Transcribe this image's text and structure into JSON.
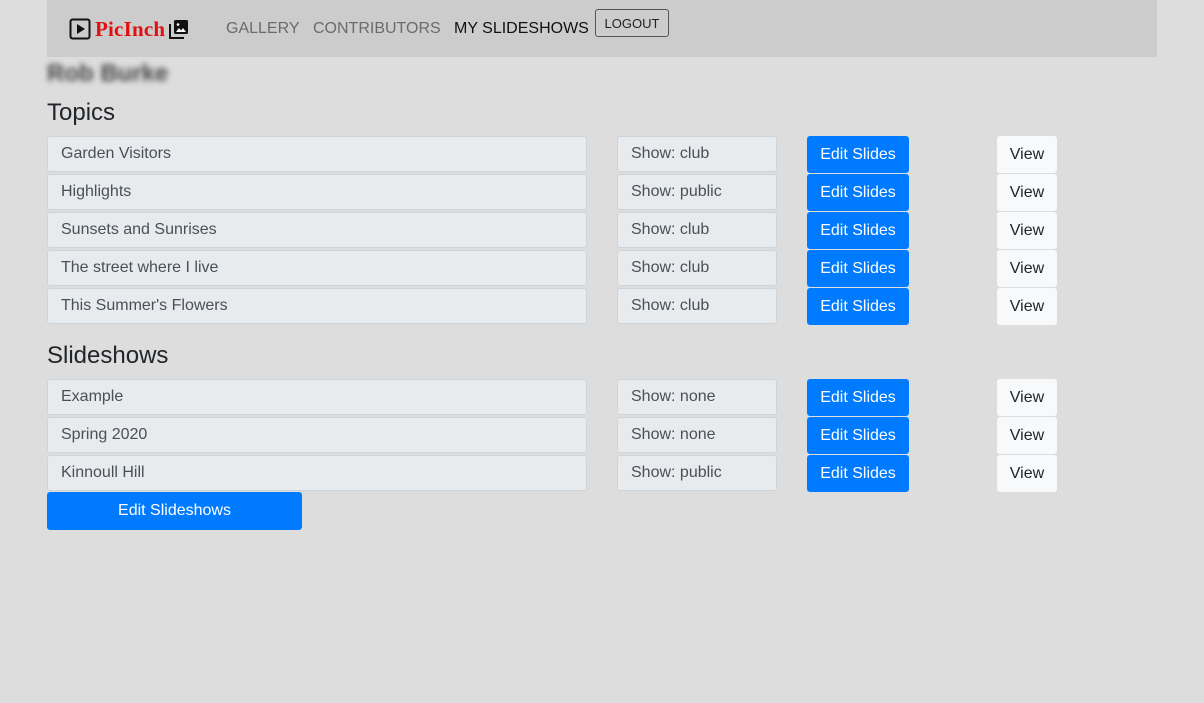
{
  "nav": {
    "brand": "PicInch",
    "brand_icons": [
      "play-icon",
      "images-icon"
    ],
    "links": [
      "GALLERY",
      "CONTRIBUTORS",
      "MY SLIDESHOWS"
    ],
    "active": "MY SLIDESHOWS",
    "logout": "LOGOUT"
  },
  "user": {
    "name": "Rob Burke"
  },
  "topics": {
    "heading": "Topics",
    "rows": [
      {
        "title": "Garden Visitors",
        "visibility": "Show: club",
        "edit": "Edit Slides",
        "view": "View"
      },
      {
        "title": "Highlights",
        "visibility": "Show: public",
        "edit": "Edit Slides",
        "view": "View"
      },
      {
        "title": "Sunsets and Sunrises",
        "visibility": "Show: club",
        "edit": "Edit Slides",
        "view": "View"
      },
      {
        "title": "The street where I live",
        "visibility": "Show: club",
        "edit": "Edit Slides",
        "view": "View"
      },
      {
        "title": "This Summer's Flowers",
        "visibility": "Show: club",
        "edit": "Edit Slides",
        "view": "View"
      }
    ]
  },
  "slideshows": {
    "heading": "Slideshows",
    "rows": [
      {
        "title": "Example",
        "visibility": "Show: none",
        "edit": "Edit Slides",
        "view": "View"
      },
      {
        "title": "Spring 2020",
        "visibility": "Show: none",
        "edit": "Edit Slides",
        "view": "View"
      },
      {
        "title": "Kinnoull Hill",
        "visibility": "Show: public",
        "edit": "Edit Slides",
        "view": "View"
      }
    ],
    "edit_all": "Edit Slideshows"
  },
  "colors": {
    "primary": "#007bff",
    "brand": "#e01010",
    "background": "#dddddd",
    "navbar": "#cccccc"
  }
}
